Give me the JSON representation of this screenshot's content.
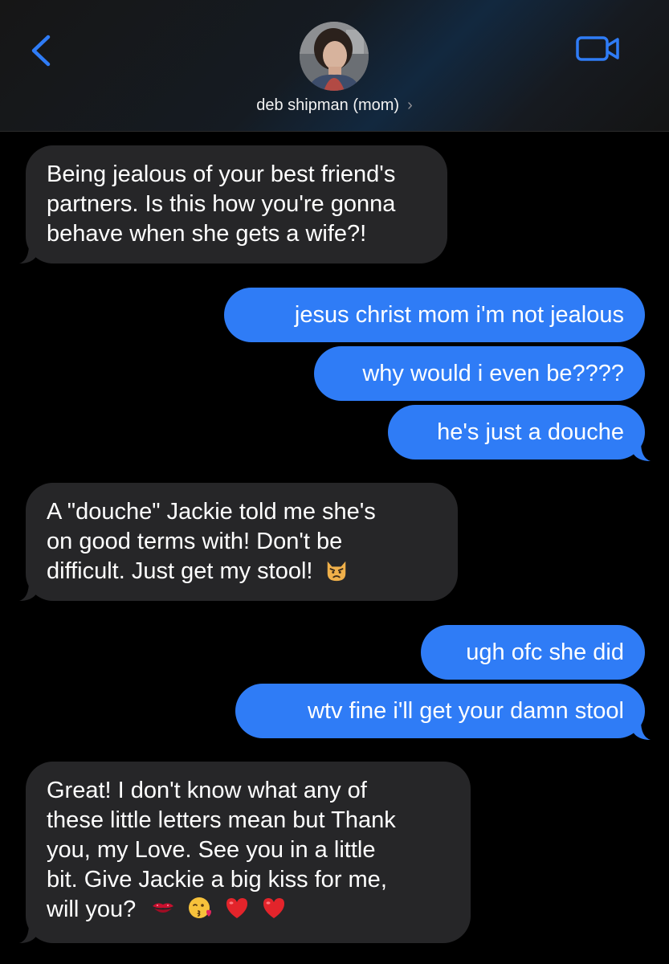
{
  "header": {
    "contact_name": "deb shipman (mom)",
    "chevron": "›",
    "back_icon": "chevron-left-icon",
    "video_icon": "video-camera-icon",
    "accent_color": "#2f7cf6"
  },
  "messages": [
    {
      "direction": "incoming",
      "lines": [
        "Being jealous of your best friend's",
        "partners. Is this how you're gonna",
        "behave when she gets a wife?!"
      ]
    },
    {
      "direction": "outgoing",
      "text": "jesus christ mom i'm not jealous"
    },
    {
      "direction": "outgoing",
      "text": "why would i even be????"
    },
    {
      "direction": "outgoing",
      "text": "he's just a douche"
    },
    {
      "direction": "incoming",
      "lines": [
        "A \"douche\" Jackie told me she's",
        "on good terms with! Don't be",
        "difficult. Just get my stool!"
      ],
      "emoji": [
        "pouting-cat-emoji"
      ]
    },
    {
      "direction": "outgoing",
      "text": "ugh ofc she did"
    },
    {
      "direction": "outgoing",
      "text": "wtv fine i'll get your damn stool"
    },
    {
      "direction": "incoming",
      "lines": [
        "Great! I don't know what any of",
        "these little letters mean but Thank",
        "you, my Love. See you in a little",
        "bit. Give Jackie a big kiss for me,",
        "will you?"
      ],
      "emoji": [
        "kiss-mark-emoji",
        "face-blowing-kiss-emoji",
        "red-heart-emoji",
        "red-heart-emoji"
      ]
    }
  ]
}
